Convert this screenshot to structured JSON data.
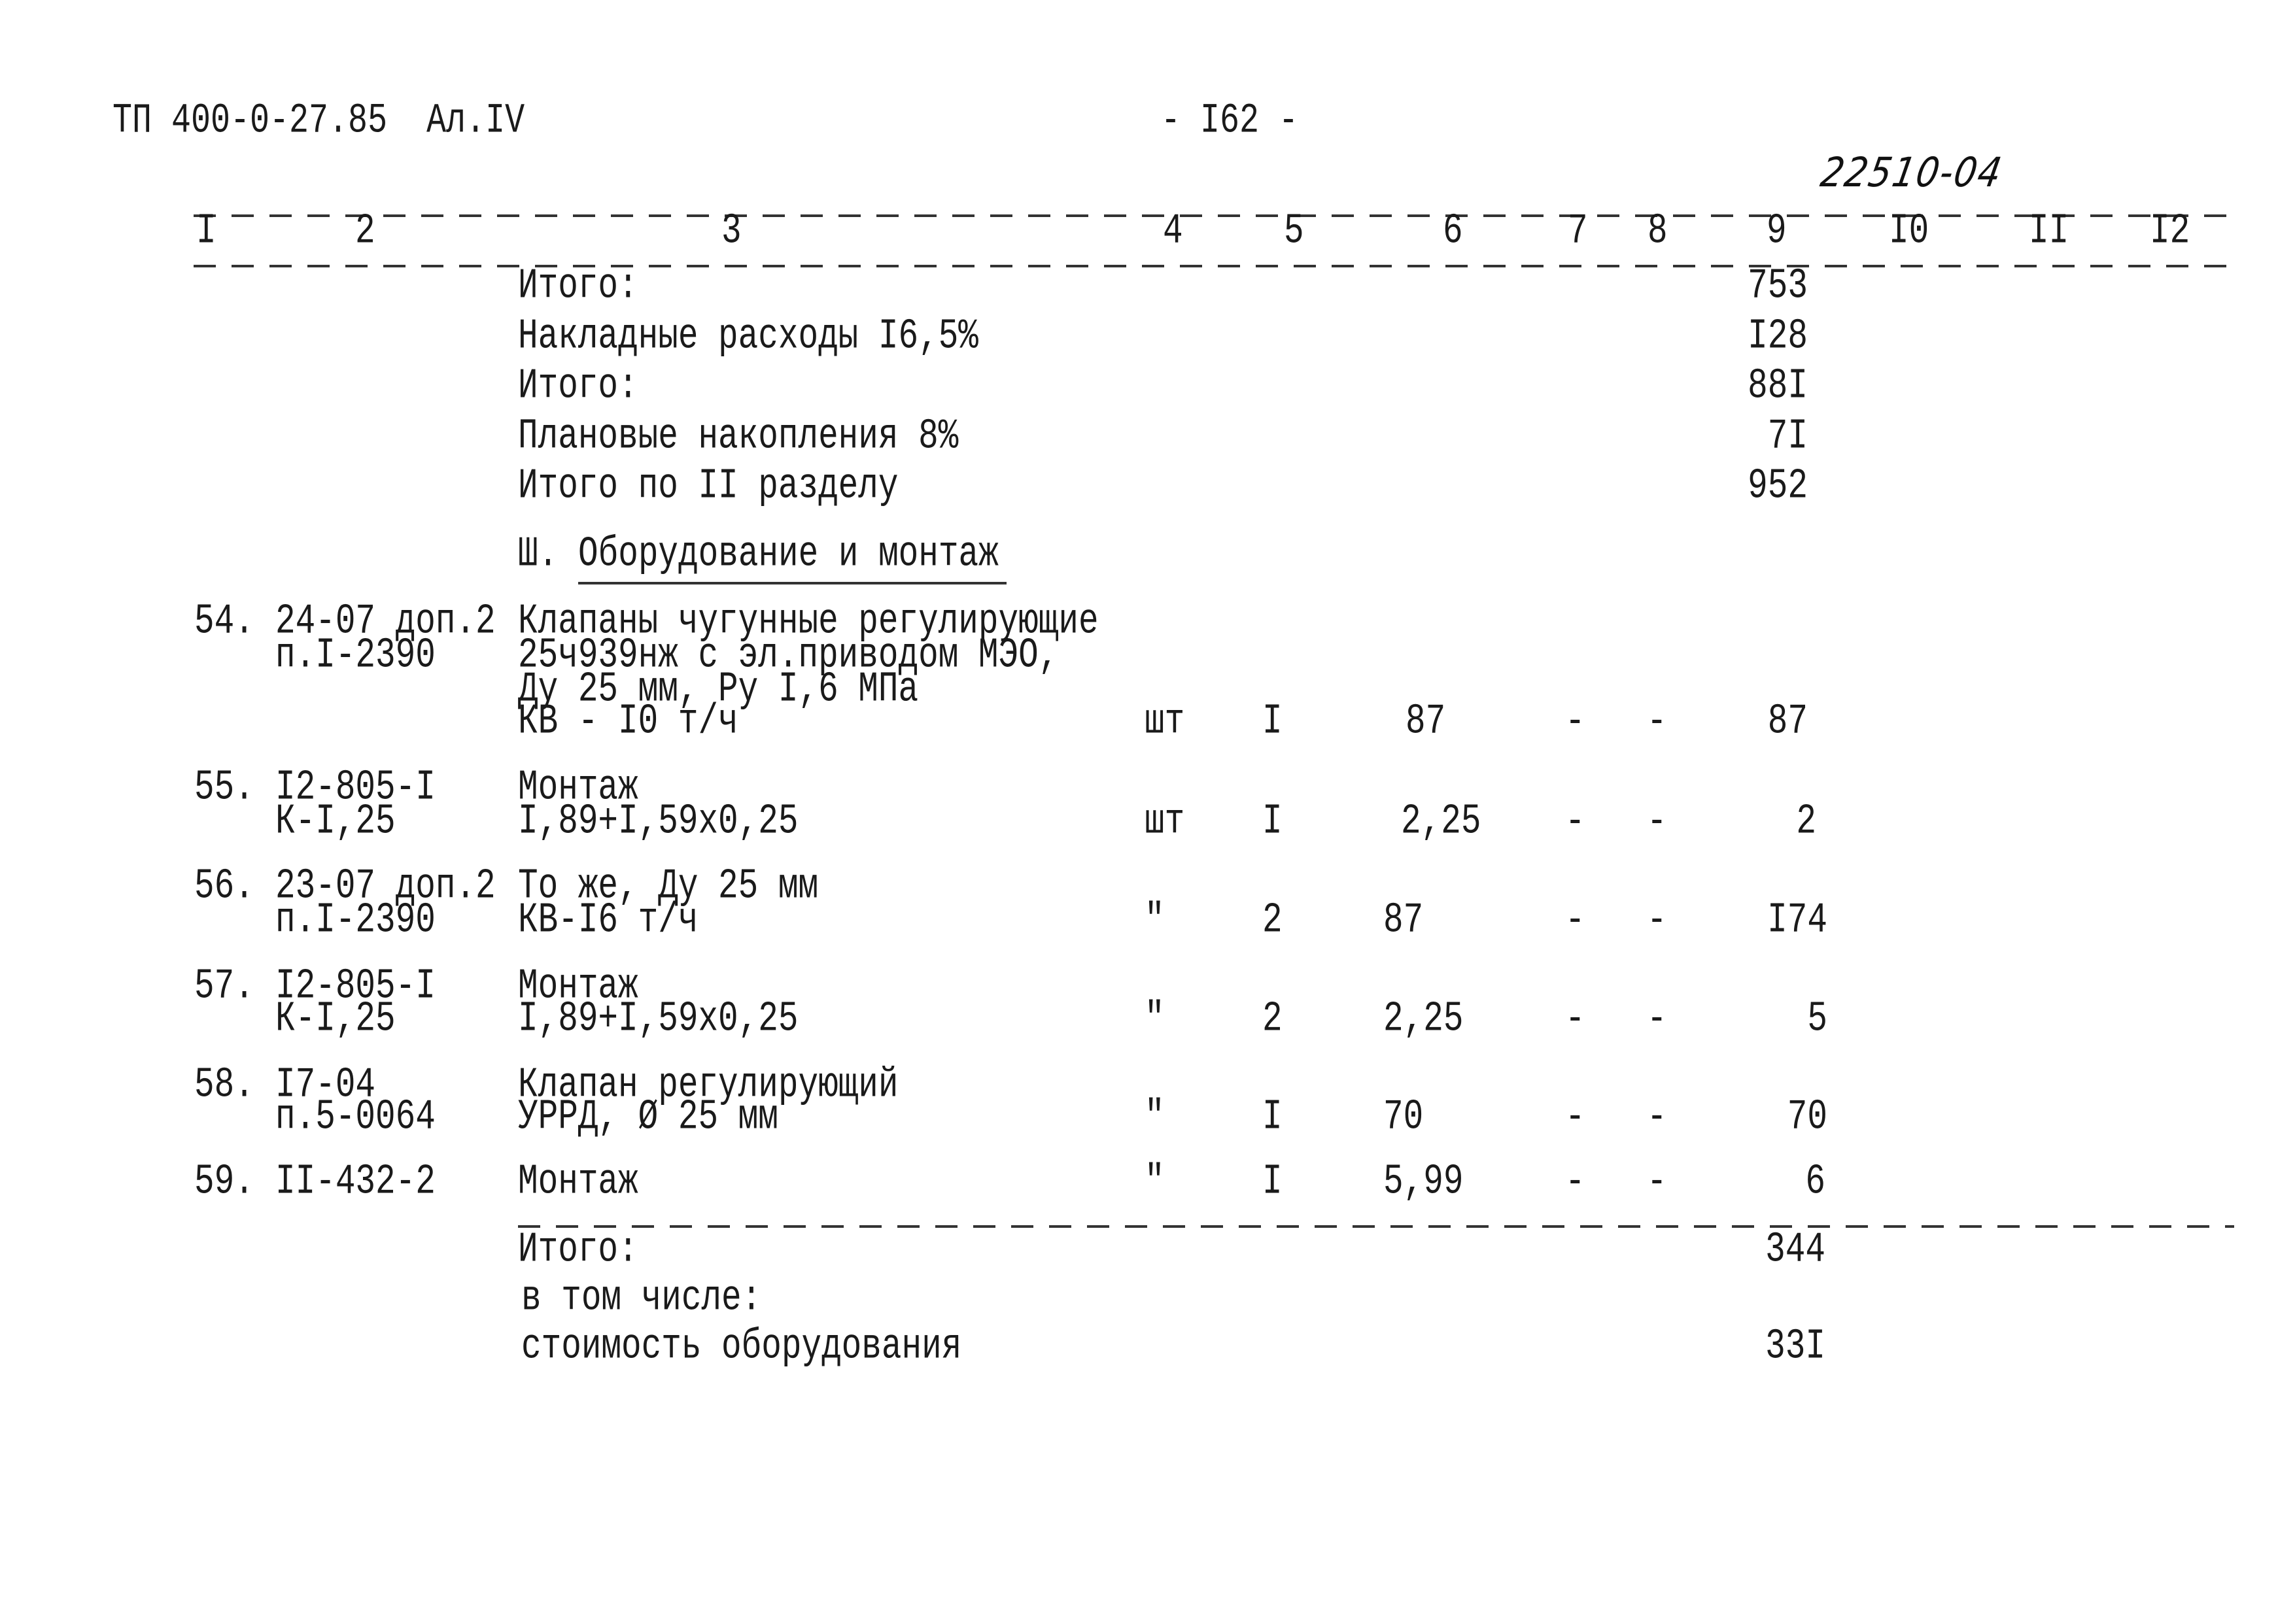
{
  "header": {
    "doc_code": "ТП 400-0-27.85  Ал.IV",
    "page_number": "- I62 -",
    "stamp": "22510-04"
  },
  "column_numbers": [
    "I",
    "2",
    "3",
    "4",
    "5",
    "6",
    "7",
    "8",
    "9",
    "I0",
    "II",
    "I2"
  ],
  "summary_top": [
    {
      "label": "Итого:",
      "total": "753"
    },
    {
      "label": "Накладные расходы I6,5%",
      "total": "I28"
    },
    {
      "label": "Итого:",
      "total": "88I"
    },
    {
      "label": "Плановые накопления 8%",
      "total": "7I"
    },
    {
      "label": "Итого по II разделу",
      "total": "952"
    }
  ],
  "section": {
    "prefix": "Ш.",
    "title": "Оборудование и монтаж"
  },
  "rows": [
    {
      "num": "54.",
      "code": [
        "24-07 доп.2",
        "п.I-2390"
      ],
      "description": [
        "Клапаны чугунные регулирующие",
        "25ч939нж с эл.приводом МЭО,",
        "Ду 25 мм, Ру I,6 МПа",
        "КВ - I0 т/ч"
      ],
      "unit": "шт",
      "qty": "I",
      "price": "87",
      "c7": "-",
      "c8": "-",
      "total": "87"
    },
    {
      "num": "55.",
      "code": [
        "I2-805-I",
        "К-I,25"
      ],
      "description": [
        "Монтаж",
        "I,89+I,59x0,25"
      ],
      "unit": "шт",
      "qty": "I",
      "price": "2,25",
      "c7": "-",
      "c8": "-",
      "total": "2"
    },
    {
      "num": "56.",
      "code": [
        "23-07 доп.2",
        "п.I-2390"
      ],
      "description": [
        "То же, Ду 25 мм",
        "КВ-I6 т/ч"
      ],
      "unit": "\"",
      "qty": "2",
      "price": "87",
      "c7": "-",
      "c8": "-",
      "total": "I74"
    },
    {
      "num": "57.",
      "code": [
        "I2-805-I",
        "К-I,25"
      ],
      "description": [
        "Монтаж",
        "I,89+I,59x0,25"
      ],
      "unit": "\"",
      "qty": "2",
      "price": "2,25",
      "c7": "-",
      "c8": "-",
      "total": "5"
    },
    {
      "num": "58.",
      "code": [
        "I7-04",
        "п.5-0064"
      ],
      "description": [
        "Клапан регулирующий",
        "УРРД, Ø 25 мм"
      ],
      "unit": "\"",
      "qty": "I",
      "price": "70",
      "c7": "-",
      "c8": "-",
      "total": "70"
    },
    {
      "num": "59.",
      "code": [
        "II-432-2"
      ],
      "description": [
        "Монтаж"
      ],
      "unit": "\"",
      "qty": "I",
      "price": "5,99",
      "c7": "-",
      "c8": "-",
      "total": "6"
    }
  ],
  "summary_bottom": [
    {
      "label": "Итого:",
      "total": "344"
    },
    {
      "label": "в том числе:",
      "total": ""
    },
    {
      "label": "стоимость оборудования",
      "total": "33I"
    }
  ]
}
